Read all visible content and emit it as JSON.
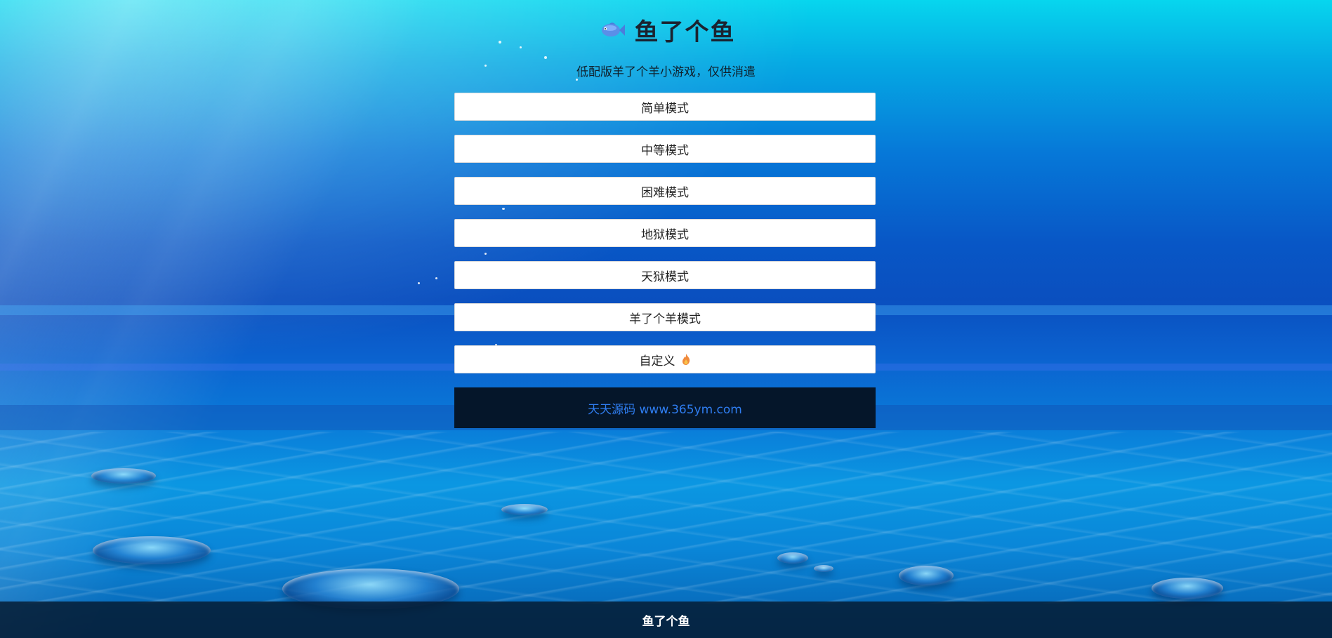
{
  "header": {
    "title": "鱼了个鱼",
    "subtitle": "低配版羊了个羊小游戏，仅供消遣",
    "icon": "fish-icon"
  },
  "menu": {
    "modes": [
      {
        "label": "简单模式"
      },
      {
        "label": "中等模式"
      },
      {
        "label": "困难模式"
      },
      {
        "label": "地狱模式"
      },
      {
        "label": "天狱模式"
      },
      {
        "label": "羊了个羊模式"
      },
      {
        "label": "自定义",
        "icon": "flame-icon"
      }
    ],
    "promo": "天天源码 www.365ym.com"
  },
  "footer": {
    "text": "鱼了个鱼"
  },
  "colors": {
    "promo_bg": "#05162a",
    "promo_text": "#2f7df0",
    "button_bg": "#ffffff",
    "footer_bg": "#05192d"
  }
}
